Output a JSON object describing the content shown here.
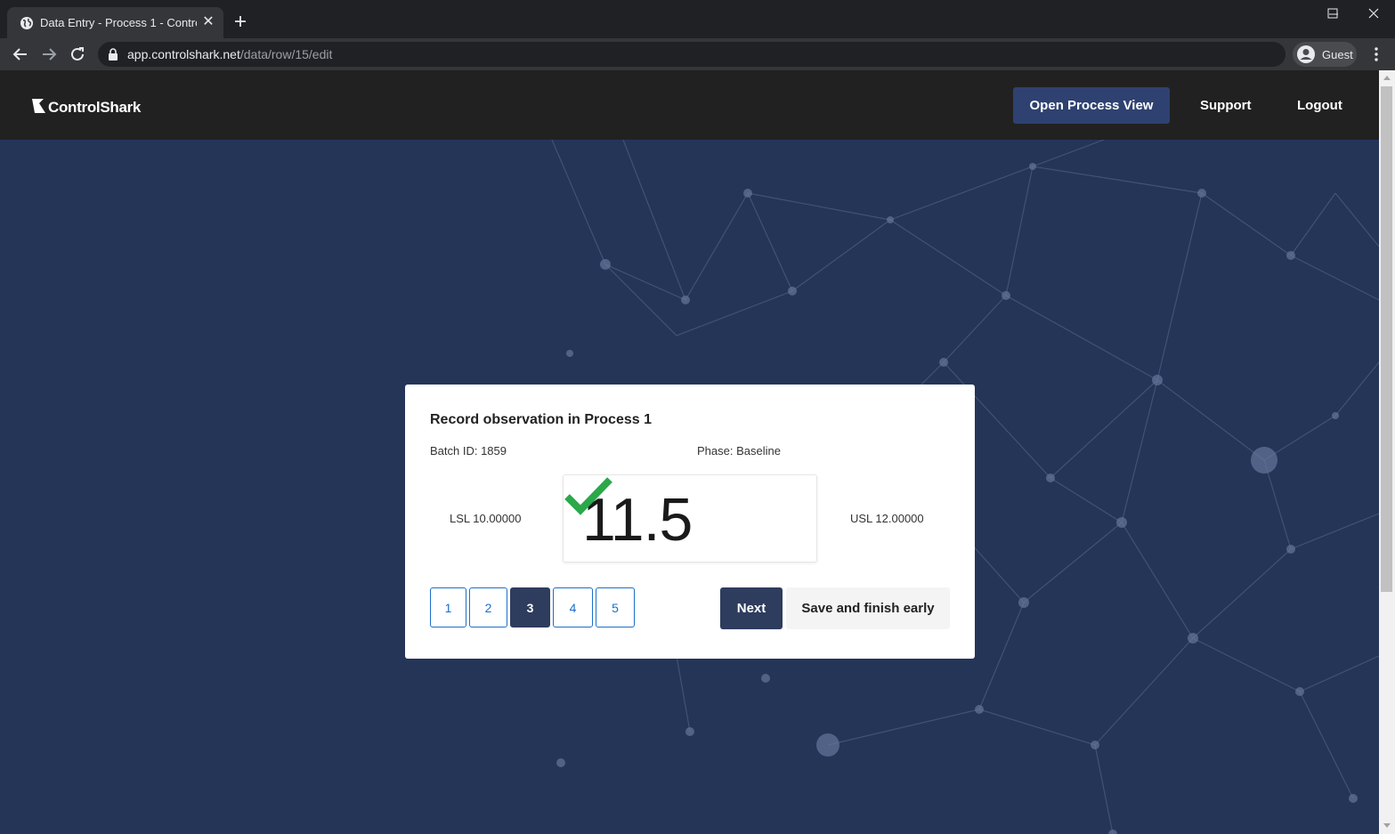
{
  "browser": {
    "tab_title": "Data Entry - Process 1 - ControlSh",
    "url_host": "app.controlshark.net",
    "url_path": "/data/row/15/edit",
    "profile_label": "Guest"
  },
  "navbar": {
    "brand": "ControlShark",
    "open_process_label": "Open Process View",
    "support_label": "Support",
    "logout_label": "Logout"
  },
  "card": {
    "title": "Record observation in Process 1",
    "batch": "Batch ID: 1859",
    "phase": "Phase: Baseline",
    "lsl": "LSL 10.00000",
    "usl": "USL 12.00000",
    "value": "11.5",
    "status_icon": "check-icon",
    "status_color": "#2aa84a",
    "pages": [
      "1",
      "2",
      "3",
      "4",
      "5"
    ],
    "active_page": "3",
    "next_label": "Next",
    "save_label": "Save and finish early"
  },
  "colors": {
    "navbar_bg": "#212121",
    "accent": "#2e4170",
    "hero_bg": "#243558",
    "link_blue": "#1a6fc9"
  }
}
